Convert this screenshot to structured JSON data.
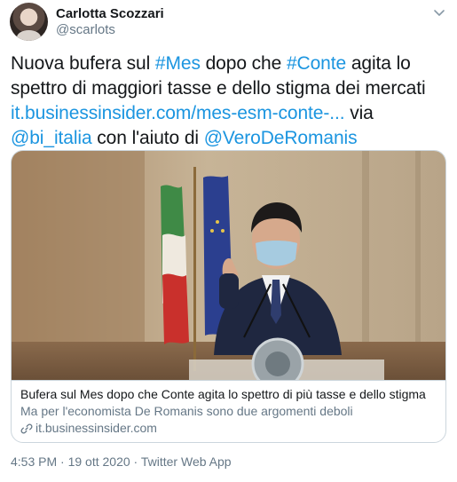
{
  "author": {
    "name": "Carlotta Scozzari",
    "handle": "@scarlots"
  },
  "tweet": {
    "t1": "Nuova bufera sul ",
    "tag1": "#Mes",
    "t2": " dopo che ",
    "tag2": "#Conte",
    "t3": " agita lo spettro di maggiori tasse e dello stigma dei mercati ",
    "link": "it.businessinsider.com/mes-esm-conte-...",
    "t4": " via ",
    "mention1": "@bi_italia",
    "t5": " con l'aiuto di ",
    "mention2": "@VeroDeRomanis"
  },
  "card": {
    "title": "Bufera sul Mes dopo che Conte agita lo spettro di più tasse e dello stigma",
    "description": "Ma per l'economista De Romanis sono due argomenti deboli",
    "domain": "it.businessinsider.com",
    "image_icon": "press-conference-photo"
  },
  "meta": {
    "time": "4:53 PM",
    "separator": "·",
    "date": "19 ott 2020",
    "source": "Twitter Web App"
  },
  "colors": {
    "link": "#1b95e0",
    "secondary_text": "#657786",
    "border": "#ccd6dd"
  },
  "icons": {
    "more": "chevron-down-icon",
    "domain": "link-icon"
  }
}
